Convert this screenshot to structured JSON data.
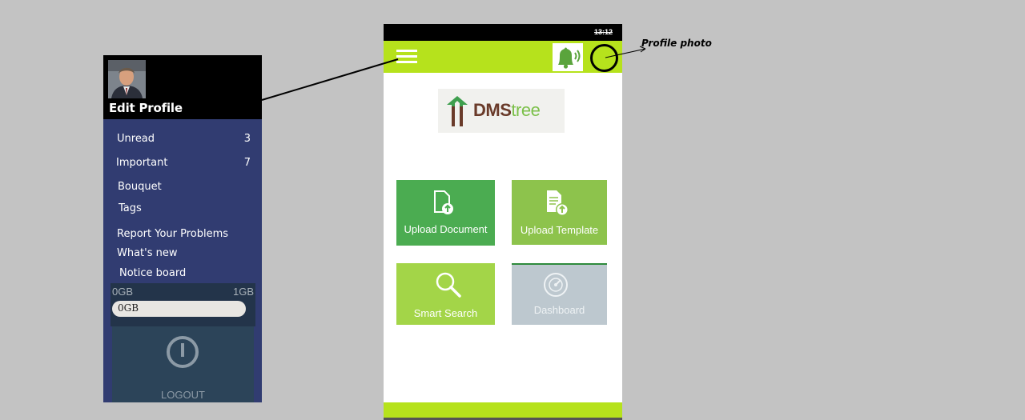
{
  "drawer": {
    "profile_label": "Edit Profile",
    "items": [
      {
        "label": "Unread",
        "count": "3"
      },
      {
        "label": "Important",
        "count": "7"
      },
      {
        "label": "Bouquet",
        "count": ""
      },
      {
        "label": "Tags",
        "count": ""
      },
      {
        "label": "Report Your Problems",
        "count": ""
      },
      {
        "label": "What's new",
        "count": ""
      },
      {
        "label": "Notice board",
        "count": ""
      }
    ],
    "storage": {
      "min": "0GB",
      "max": "1GB",
      "used": "0GB",
      "fraction": 0
    },
    "logout_label": "LOGOUT",
    "logout_icon": "power-icon"
  },
  "phone": {
    "status_time": "13:12",
    "logo": {
      "part1": "DMS",
      "part2": "tree"
    },
    "tiles": [
      {
        "label": "Upload Document",
        "icon": "upload-document-icon"
      },
      {
        "label": "Upload Template",
        "icon": "upload-template-icon"
      },
      {
        "label": "Smart Search",
        "icon": "search-icon"
      },
      {
        "label": "Dashboard",
        "icon": "dashboard-icon"
      }
    ],
    "colors": {
      "accent": "#b6e21c",
      "upload_document": "#4bac51",
      "upload_template": "#8dc34c",
      "smart_search": "#a3d548",
      "dashboard": "#bdc8cf"
    }
  },
  "annotation": {
    "profile_photo_label": "Profile photo"
  }
}
